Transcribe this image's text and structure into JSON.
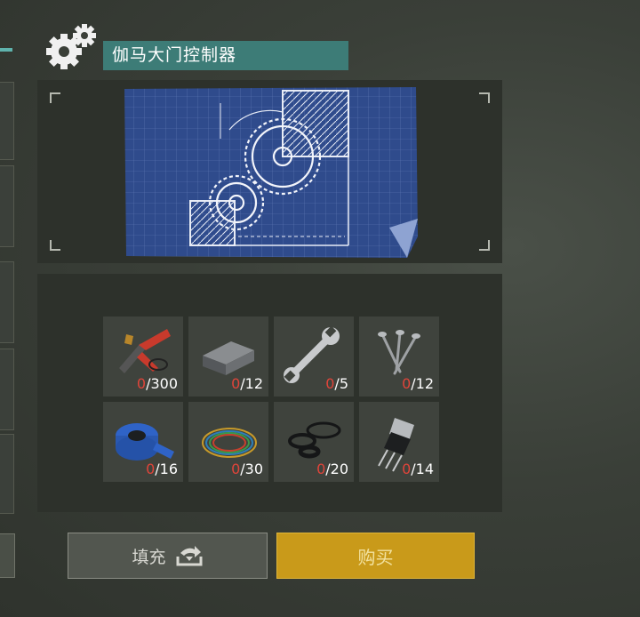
{
  "header": {
    "title": "伽马大门控制器",
    "icon": "gears-icon"
  },
  "blueprint": {
    "icon": "blueprint-gears-image"
  },
  "materials": [
    {
      "name": "pliers-wires",
      "have": "0",
      "need": "/300"
    },
    {
      "name": "metal-ingot",
      "have": "0",
      "need": "/12"
    },
    {
      "name": "wrench",
      "have": "0",
      "need": "/5"
    },
    {
      "name": "nails",
      "have": "0",
      "need": "/12"
    },
    {
      "name": "blue-tape",
      "have": "0",
      "need": "/16"
    },
    {
      "name": "wire-bundle",
      "have": "0",
      "need": "/30"
    },
    {
      "name": "rubber-seals",
      "have": "0",
      "need": "/20"
    },
    {
      "name": "transistor",
      "have": "0",
      "need": "/14"
    }
  ],
  "actions": {
    "fill_label": "填充",
    "buy_label": "购买"
  },
  "colors": {
    "title_bg": "#3d7c77",
    "buy_bg": "#c99a1a",
    "missing_count": "#e0443a"
  }
}
